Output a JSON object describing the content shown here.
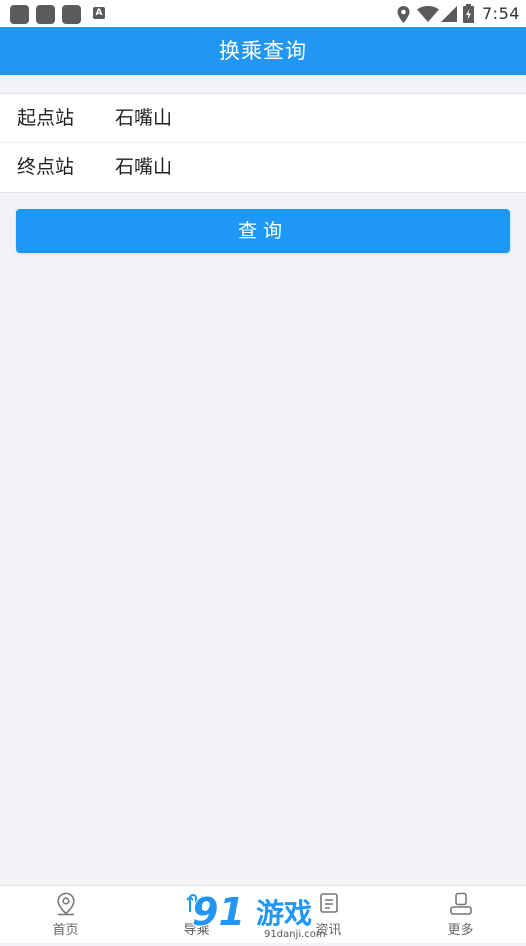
{
  "status_bar": {
    "time": "7:54",
    "notification_badge": "A",
    "icons": [
      "app-icon",
      "app-icon",
      "app-icon",
      "a-badge-icon",
      "location-icon",
      "wifi-icon",
      "signal-icon",
      "battery-icon"
    ]
  },
  "header": {
    "title": "换乘查询"
  },
  "form": {
    "start_label": "起点站",
    "start_value": "石嘴山",
    "end_label": "终点站",
    "end_value": "石嘴山"
  },
  "query_button": {
    "label": "查询"
  },
  "tabs": [
    {
      "label": "首页",
      "icon": "location-pin-icon"
    },
    {
      "label": "导乘",
      "icon": "route-icon"
    },
    {
      "label": "资讯",
      "icon": "news-icon"
    },
    {
      "label": "更多",
      "icon": "user-icon"
    }
  ],
  "watermark": {
    "text": "91游戏",
    "url": "91danji.com"
  },
  "colors": {
    "primary": "#2196f3",
    "button": "#1e98f5",
    "background": "#f2f3f7"
  }
}
